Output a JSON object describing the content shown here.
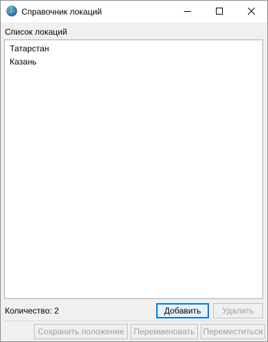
{
  "window": {
    "title": "Справочник локаций"
  },
  "list": {
    "caption": "Список локаций",
    "items": [
      "Татарстан",
      "Казань"
    ]
  },
  "count": {
    "label": "Количество: 2"
  },
  "buttons": {
    "add": "Добавить",
    "delete": "Удалить",
    "save_position": "Сохранить положение",
    "rename": "Переименовать",
    "move": "Переместиться"
  },
  "icons": {
    "app": "globe-icon",
    "minimize": "minimize-icon",
    "maximize": "maximize-icon",
    "close": "close-icon"
  },
  "colors": {
    "accent": "#0078d7",
    "disabled_text": "#a0a0a0"
  }
}
